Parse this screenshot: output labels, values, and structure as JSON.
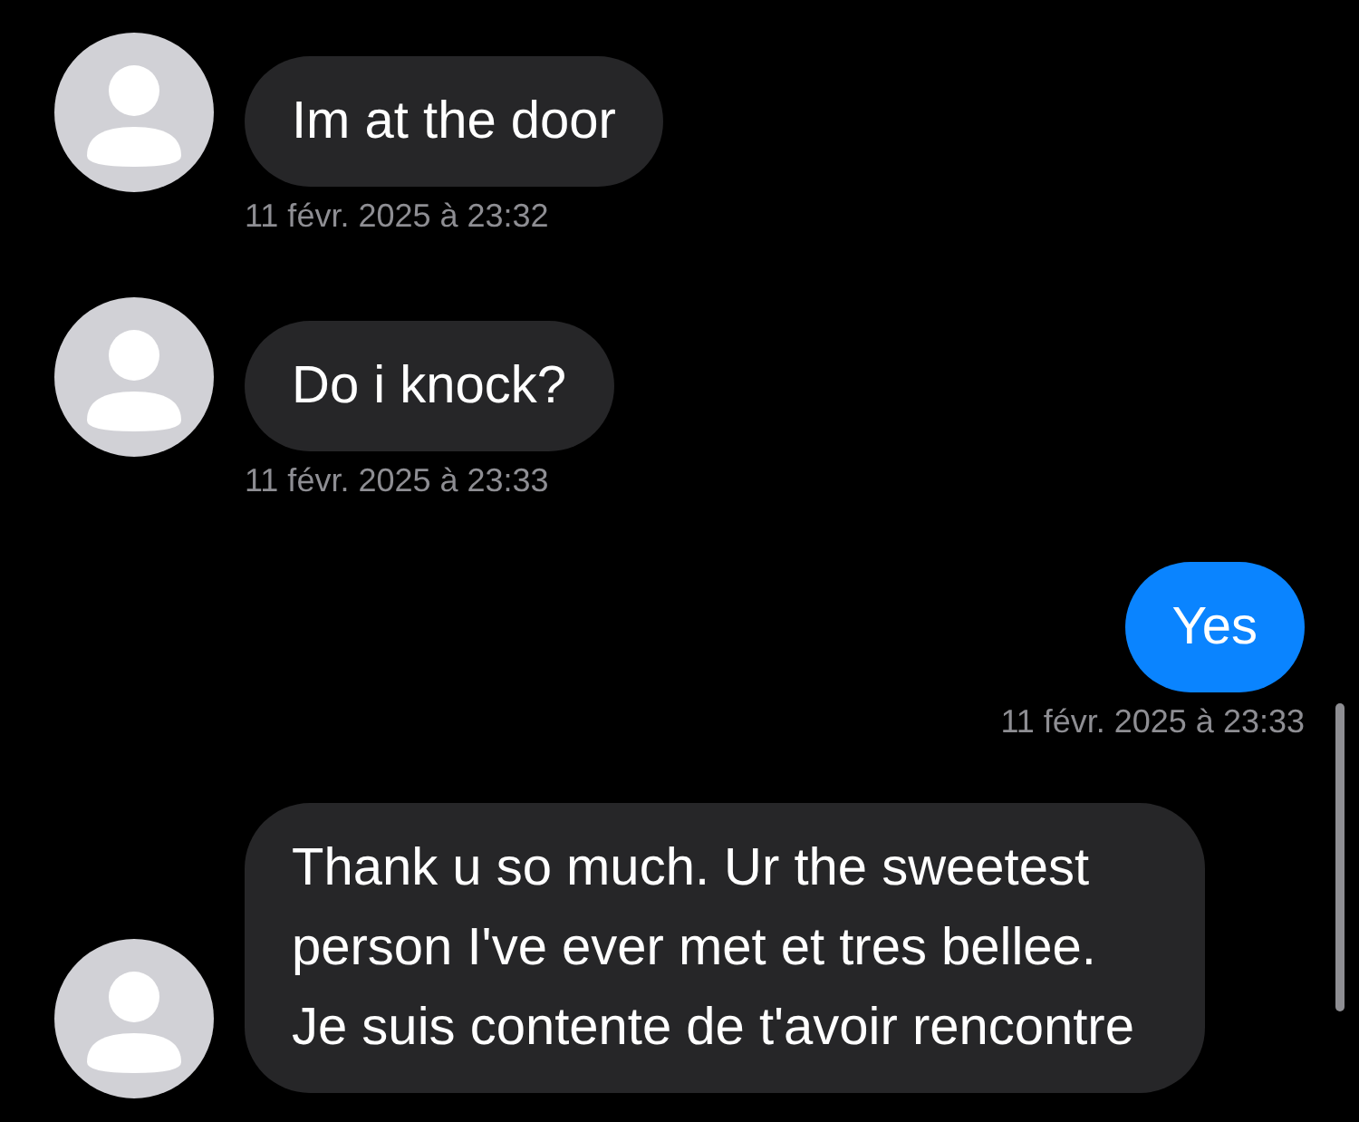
{
  "messages": [
    {
      "kind": "received",
      "text": "Im at the door",
      "timestamp": "11 févr. 2025 à 23:32"
    },
    {
      "kind": "received",
      "text": "Do i knock?",
      "timestamp": "11 févr. 2025 à 23:33"
    },
    {
      "kind": "sent",
      "text": "Yes",
      "timestamp": "11 févr. 2025 à 23:33"
    },
    {
      "kind": "received",
      "text": "Thank u so much. Ur the sweetest person I've ever met et tres bellee. Je suis contente de t'avoir rencontre"
    }
  ]
}
